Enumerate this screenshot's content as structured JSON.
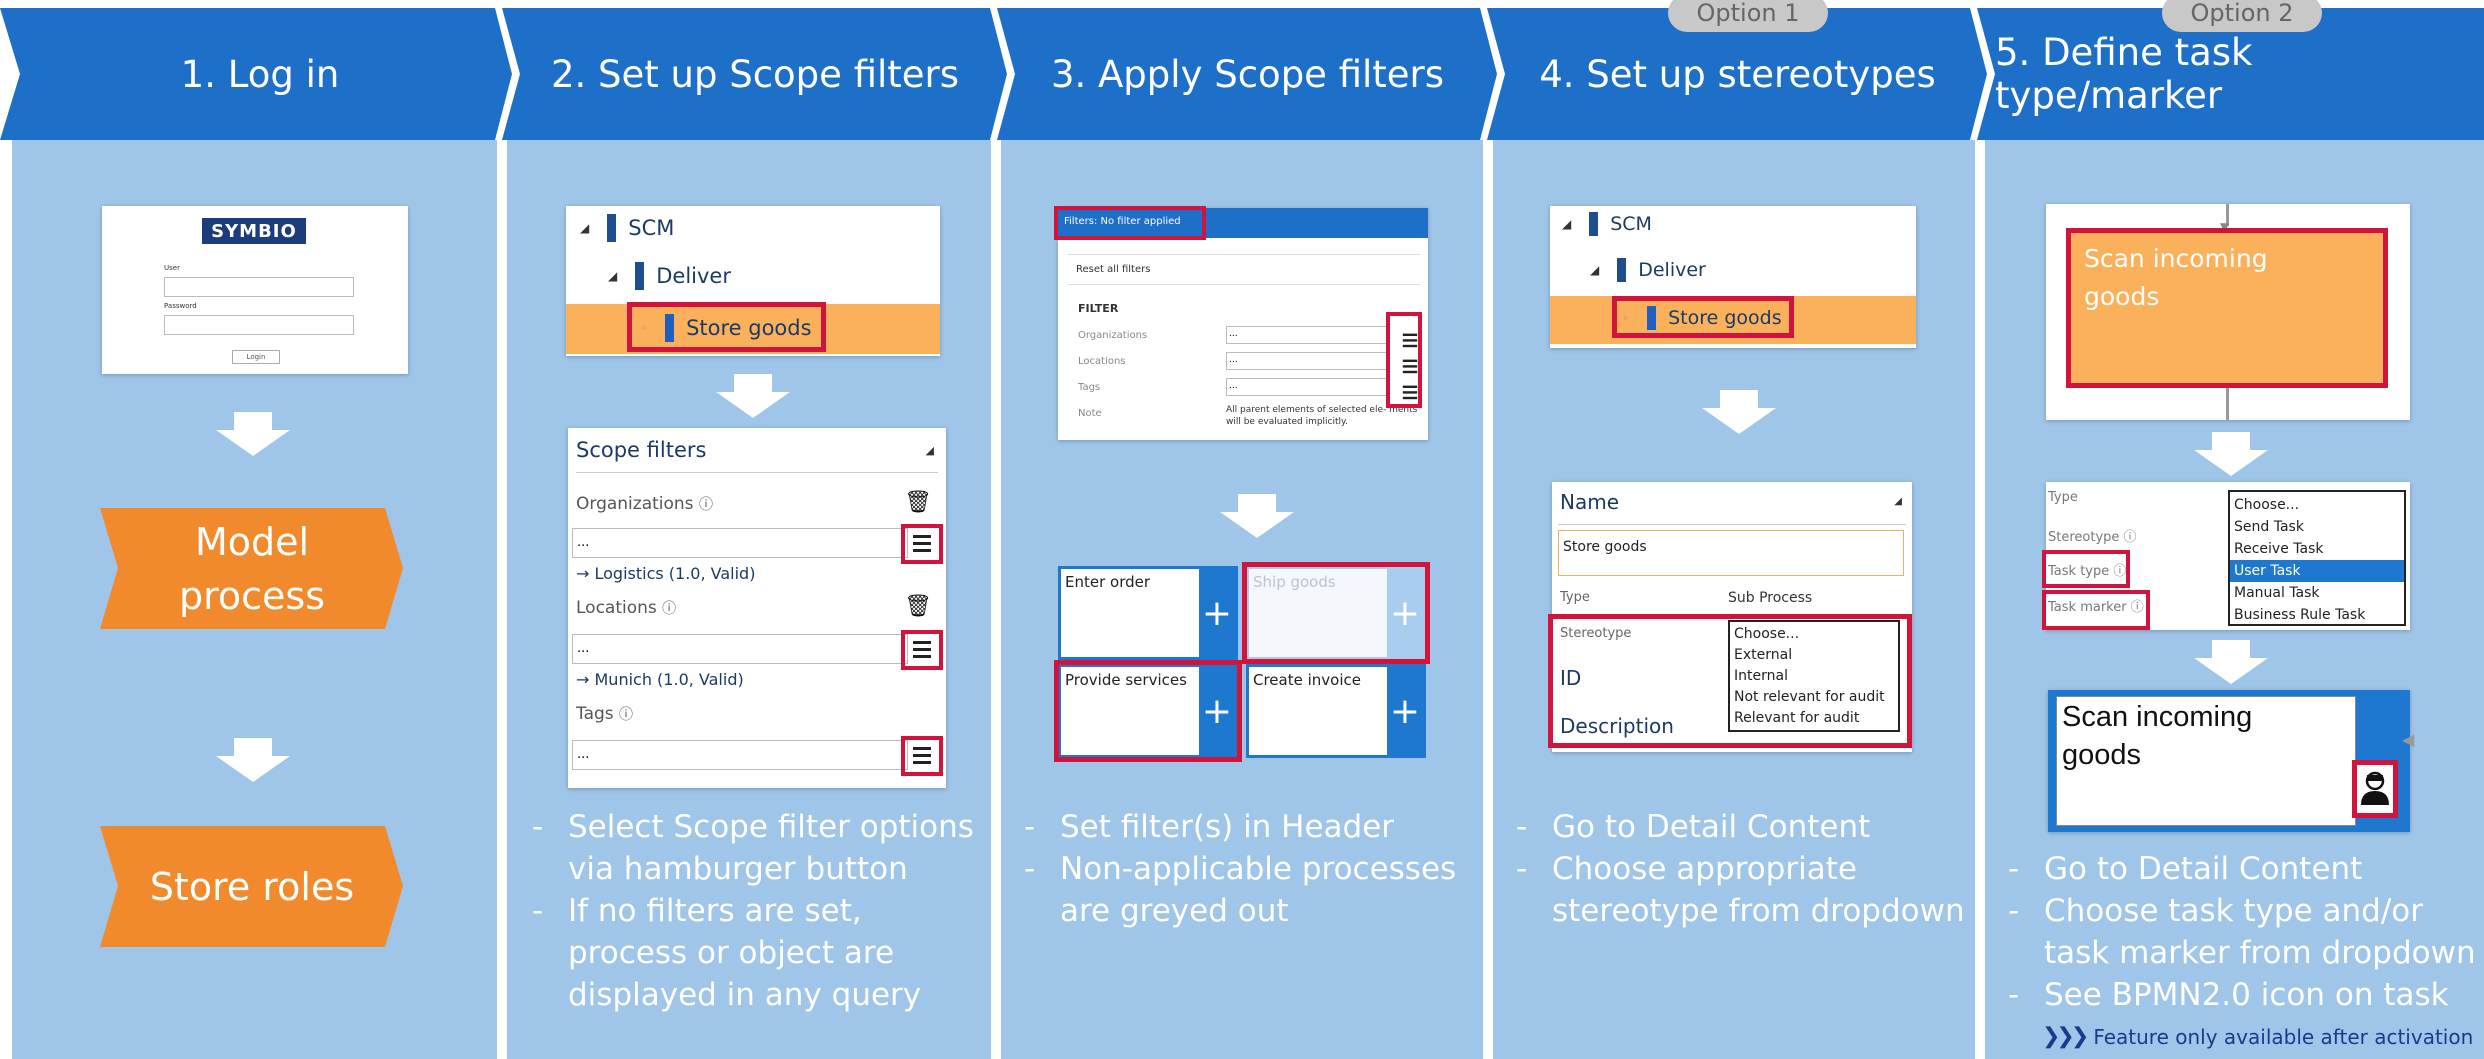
{
  "steps": [
    {
      "title": "1. Log in"
    },
    {
      "title": "2. Set up Scope filters"
    },
    {
      "title": "3. Apply Scope filters"
    },
    {
      "title": "4. Set up stereotypes",
      "option": "Option 1"
    },
    {
      "title": "5. Define task type/marker",
      "option": "Option 2"
    }
  ],
  "col1": {
    "logo": "SYMBIO",
    "user_label": "User",
    "password_label": "Password",
    "login_button": "Login",
    "model_process": "Model process",
    "store_roles": "Store roles"
  },
  "col2": {
    "tree": {
      "root": "SCM",
      "child": "Deliver",
      "leaf": "Store goods"
    },
    "scope_title": "Scope filters",
    "organizations_label": "Organizations",
    "org_value": "...",
    "org_selected": "Logistics (1.0, Valid)",
    "locations_label": "Locations",
    "loc_value": "...",
    "loc_selected": "Munich (1.0, Valid)",
    "tags_label": "Tags",
    "tags_value": "...",
    "bullets": [
      "Select Scope filter options via hamburger button",
      "If no filters are set, process or object are displayed in any query"
    ]
  },
  "col3": {
    "header": "Filters: No filter applied",
    "reset": "Reset all filters",
    "filter_heading": "FILTER",
    "organizations": "Organizations",
    "locations": "Locations",
    "tags": "Tags",
    "note_label": "Note",
    "note_text": "All parent elements of selected ele- ments will be evaluated implicitly.",
    "dots": "...",
    "tiles": [
      "Enter order",
      "Ship goods",
      "Provide services",
      "Create invoice"
    ],
    "bullets": [
      "Set filter(s) in Header",
      "Non-applicable processes are greyed out"
    ]
  },
  "col4": {
    "tree": {
      "root": "SCM",
      "child": "Deliver",
      "leaf": "Store goods"
    },
    "name_label": "Name",
    "name_value": "Store goods",
    "type_label": "Type",
    "type_value": "Sub Process",
    "stereotype_label": "Stereotype",
    "id_label": "ID",
    "description_label": "Description",
    "options": [
      "Choose...",
      "External",
      "Internal",
      "Not relevant for audit",
      "Relevant for audit"
    ],
    "bullets": [
      "Go to Detail Content",
      "Choose appropriate stereotype from dropdown"
    ]
  },
  "col5": {
    "task_text": "Scan incoming goods",
    "type_label": "Type",
    "stereotype_label": "Stereotype",
    "task_type_label": "Task type",
    "task_marker_label": "Task marker",
    "options": [
      "Choose...",
      "Send Task",
      "Receive Task",
      "User Task",
      "Manual Task",
      "Business Rule Task"
    ],
    "task_text2": "Scan incoming goods",
    "bullets": [
      "Go to Detail Content",
      "Choose task type and/or task marker from dropdown",
      "See BPMN2.0 icon on task"
    ],
    "feature_note": "Feature only available after activation"
  },
  "colors": {
    "header_blue": "#1e6fc7",
    "panel_blue": "#9fc5e9",
    "orange": "#f08a2c",
    "highlight_red": "#d0143c",
    "row_orange": "#fbb15c"
  }
}
